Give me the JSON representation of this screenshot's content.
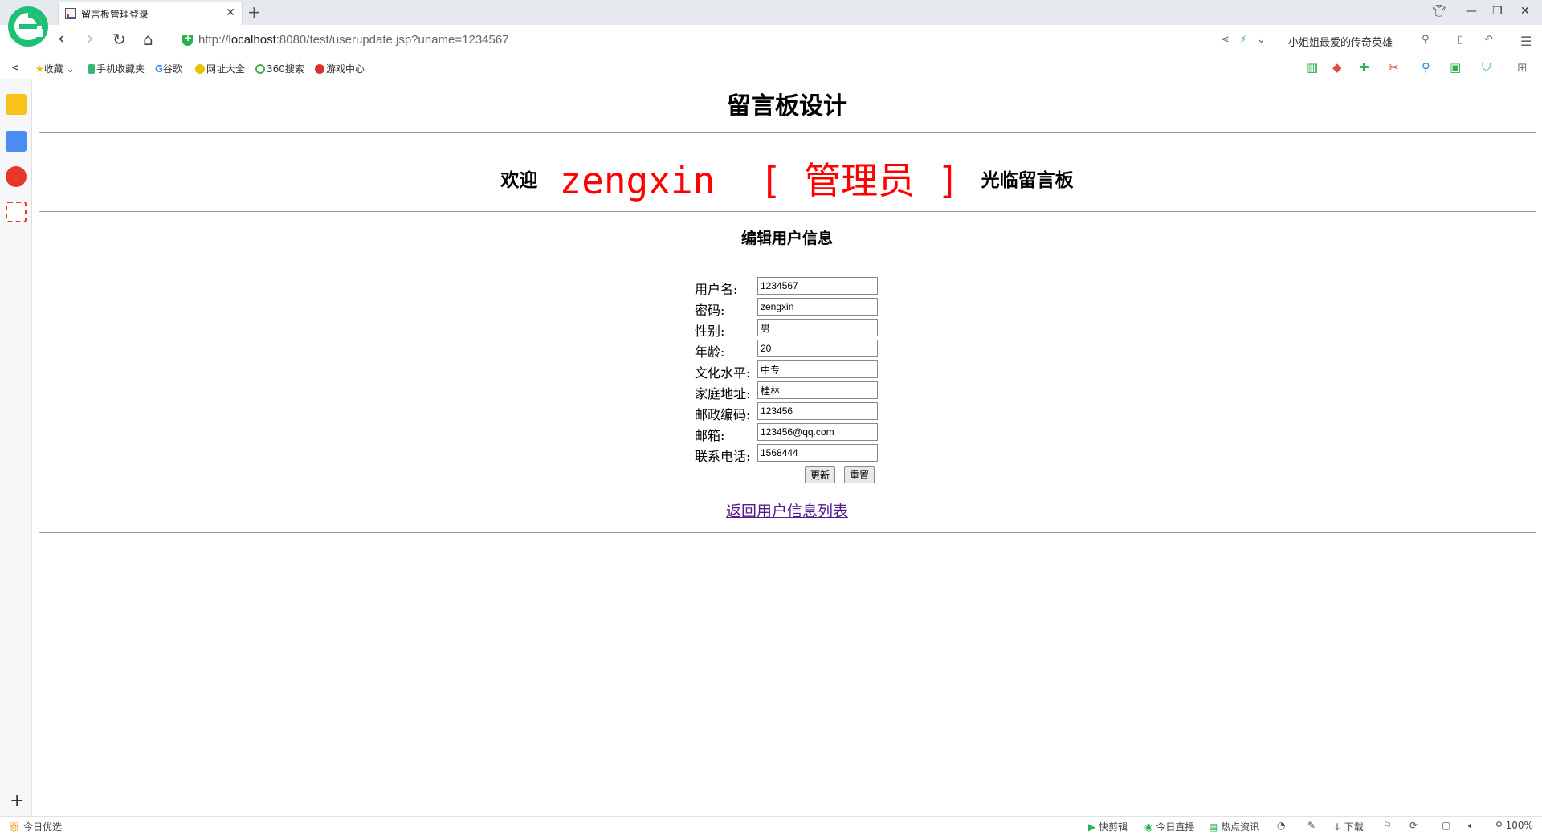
{
  "browser": {
    "tab_title": "留言板管理登录",
    "url_prefix": "http://",
    "url_host": "localhost",
    "url_rest": ":8080/test/userupdate.jsp?uname=1234567",
    "search_suggestion": "小姐姐最爱的传奇英雄",
    "zoom": "100%"
  },
  "bookmarks": [
    {
      "label": "收藏",
      "icon": "star-icon"
    },
    {
      "label": "手机收藏夹",
      "icon": "phone-icon"
    },
    {
      "label": "谷歌",
      "icon": "google-icon"
    },
    {
      "label": "网址大全",
      "icon": "sites-icon"
    },
    {
      "label": "360搜索",
      "icon": "search360-icon"
    },
    {
      "label": "游戏中心",
      "icon": "game-icon"
    }
  ],
  "statusbar": {
    "left": "今日优选",
    "items": [
      "快剪辑",
      "今日直播",
      "热点资讯",
      "下载",
      "100%"
    ]
  },
  "page": {
    "title": "留言板设计",
    "welcome_prefix": "欢迎",
    "welcome_user": "zengxin",
    "welcome_role": "[ 管理员 ]",
    "welcome_suffix": "光临留言板",
    "section_title": "编辑用户信息",
    "fields": [
      {
        "label": "用户名:",
        "value": "1234567"
      },
      {
        "label": "密码:",
        "value": "zengxin"
      },
      {
        "label": "性别:",
        "value": "男"
      },
      {
        "label": "年龄:",
        "value": "20"
      },
      {
        "label": "文化水平:",
        "value": "中专"
      },
      {
        "label": "家庭地址:",
        "value": "桂林"
      },
      {
        "label": "邮政编码:",
        "value": "123456"
      },
      {
        "label": "邮箱:",
        "value": "123456@qq.com"
      },
      {
        "label": "联系电话:",
        "value": "1568444"
      }
    ],
    "update_button": "更新",
    "reset_button": "重置",
    "back_link": "返回用户信息列表"
  }
}
